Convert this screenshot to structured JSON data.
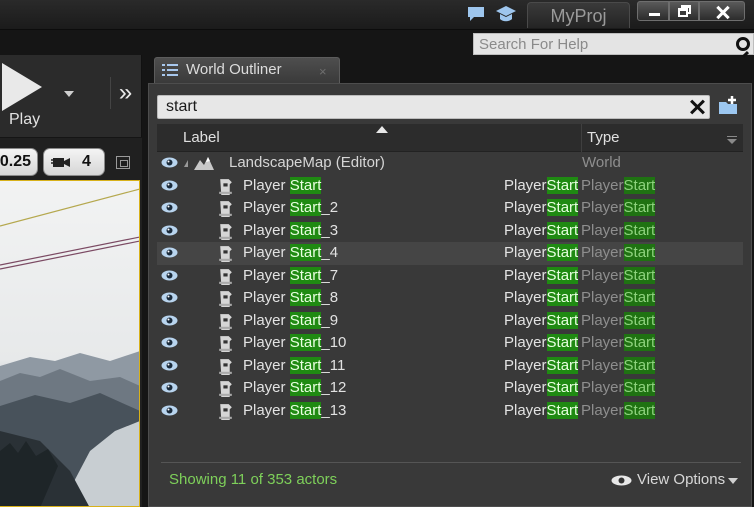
{
  "window": {
    "project_tab": "MyProj",
    "controls": [
      "minimize",
      "maximize",
      "close"
    ]
  },
  "help_search": {
    "placeholder": "Search For Help",
    "value": ""
  },
  "toolbar": {
    "play_label": "Play"
  },
  "viewport": {
    "scale_value": "0.25",
    "camera_speed": "4"
  },
  "outliner": {
    "tab_title": "World Outliner",
    "tab_close": "×",
    "search_value": "start",
    "columns": {
      "label": "Label",
      "type": "Type"
    },
    "root": {
      "label": "LandscapeMap (Editor)",
      "type": "World"
    },
    "actors": [
      {
        "prefix": "Player ",
        "match": "Start",
        "suffix": "",
        "type_a": "Player",
        "type_b": "Start",
        "type_c": "Player",
        "type_d": "Start"
      },
      {
        "prefix": "Player ",
        "match": "Start",
        "suffix": "_2",
        "type_a": "Player",
        "type_b": "Start",
        "type_c": "Player",
        "type_d": "Start"
      },
      {
        "prefix": "Player ",
        "match": "Start",
        "suffix": "_3",
        "type_a": "Player",
        "type_b": "Start",
        "type_c": "Player",
        "type_d": "Start"
      },
      {
        "prefix": "Player ",
        "match": "Start",
        "suffix": "_4",
        "type_a": "Player",
        "type_b": "Start",
        "type_c": "Player",
        "type_d": "Start"
      },
      {
        "prefix": "Player ",
        "match": "Start",
        "suffix": "_7",
        "type_a": "Player",
        "type_b": "Start",
        "type_c": "Player",
        "type_d": "Start"
      },
      {
        "prefix": "Player ",
        "match": "Start",
        "suffix": "_8",
        "type_a": "Player",
        "type_b": "Start",
        "type_c": "Player",
        "type_d": "Start"
      },
      {
        "prefix": "Player ",
        "match": "Start",
        "suffix": "_9",
        "type_a": "Player",
        "type_b": "Start",
        "type_c": "Player",
        "type_d": "Start"
      },
      {
        "prefix": "Player ",
        "match": "Start",
        "suffix": "_10",
        "type_a": "Player",
        "type_b": "Start",
        "type_c": "Player",
        "type_d": "Start"
      },
      {
        "prefix": "Player ",
        "match": "Start",
        "suffix": "_11",
        "type_a": "Player",
        "type_b": "Start",
        "type_c": "Player",
        "type_d": "Start"
      },
      {
        "prefix": "Player ",
        "match": "Start",
        "suffix": "_12",
        "type_a": "Player",
        "type_b": "Start",
        "type_c": "Player",
        "type_d": "Start"
      },
      {
        "prefix": "Player ",
        "match": "Start",
        "suffix": "_13",
        "type_a": "Player",
        "type_b": "Start",
        "type_c": "Player",
        "type_d": "Start"
      }
    ],
    "highlighted_row": 3,
    "status": "Showing 11 of 353 actors",
    "view_options": "View Options"
  },
  "colors": {
    "match_highlight": "#1f8a12",
    "status_text": "#7ed05a",
    "viewport_border": "#d8b11a"
  }
}
